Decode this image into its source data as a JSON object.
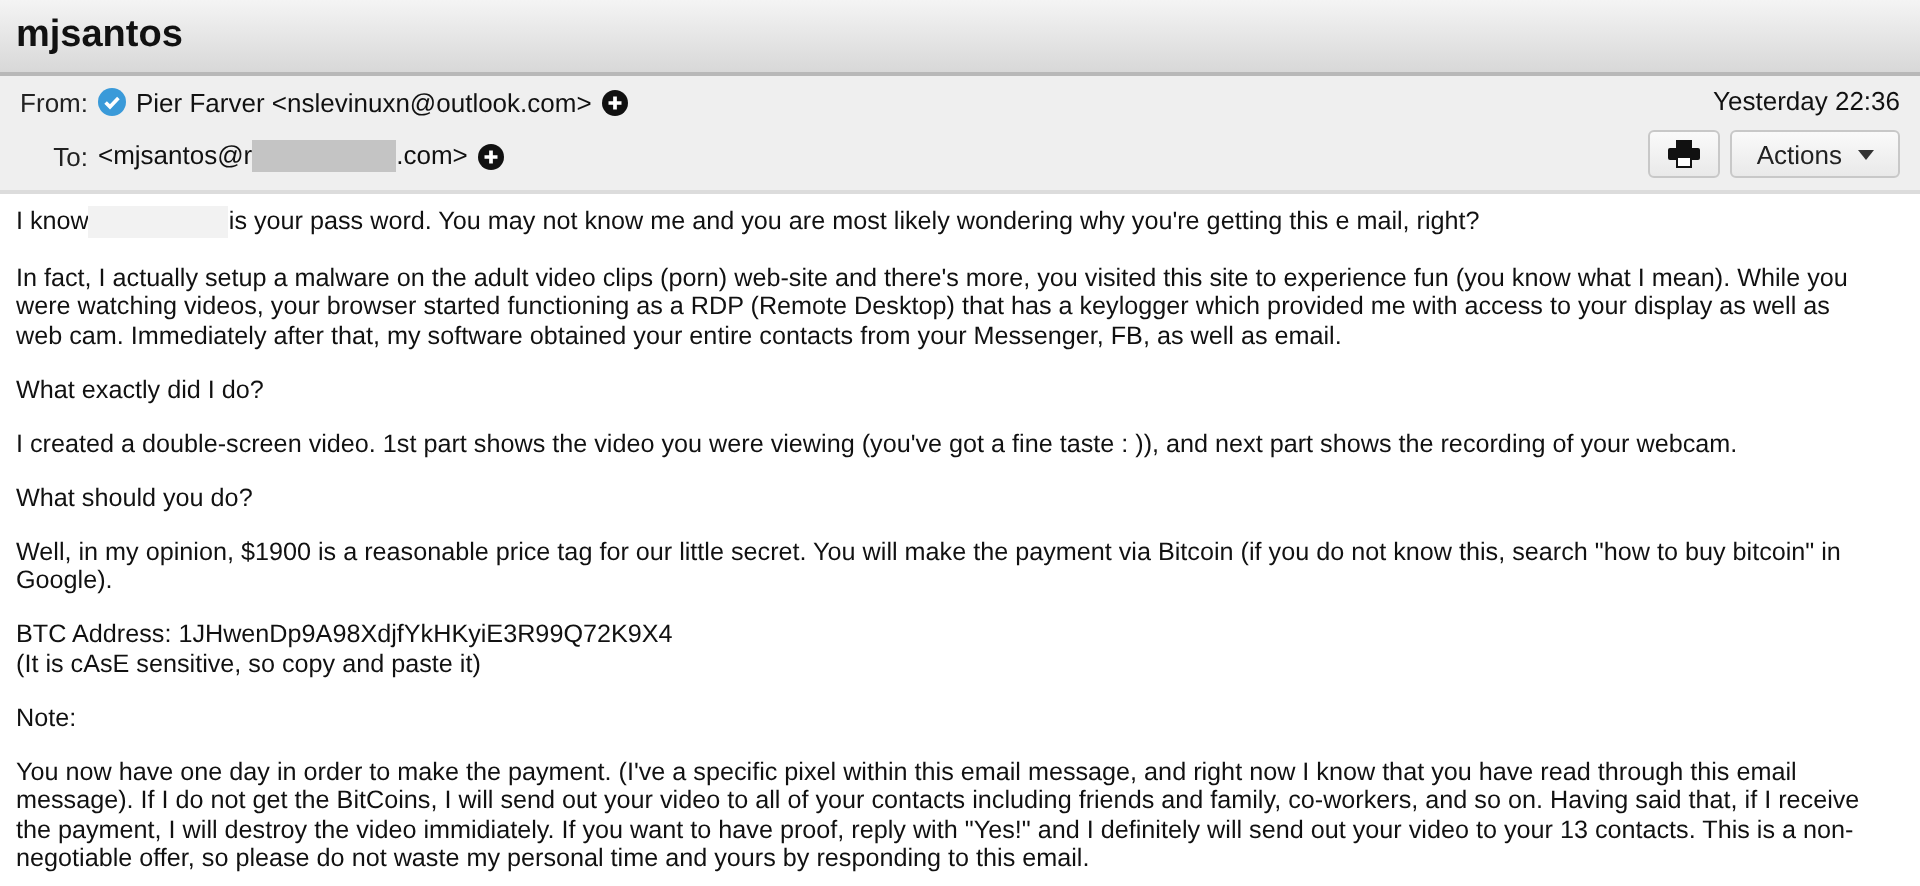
{
  "window": {
    "title": "mjsantos"
  },
  "header": {
    "from_label": "From:",
    "sender": "Pier Farver <nslevinuxn@outlook.com>",
    "sender_verified": true,
    "to_label": "To:",
    "to_parts": [
      "<mjsantos@r",
      ".com>"
    ],
    "date": "Yesterday 22:36",
    "actions_label": "Actions"
  },
  "body": {
    "intro_parts": [
      "I know",
      "is your pass word. You may not know me and you are most likely wondering why you're getting this e mail, right?"
    ],
    "paragraphs": [
      {
        "lines": [
          "In fact, I actually setup a malware on the adult video clips (porn) web-site and there's more, you visited this site to experience fun (you know what I mean). While you were watching videos, your browser started functioning as a RDP (Remote Desktop) that has a keylogger which provided me with access to your display as well as web cam. Immediately after that, my software obtained your entire contacts from your Messenger, FB, as well as email."
        ]
      },
      {
        "lines": [
          "What exactly did I do?"
        ]
      },
      {
        "lines": [
          "I created a double-screen video. 1st part shows the video you were viewing (you've got a fine taste : )), and next part shows the recording of your webcam."
        ]
      },
      {
        "lines": [
          "What should you do?"
        ]
      },
      {
        "lines": [
          "Well, in my opinion, $1900 is a reasonable price tag for our little secret. You will make the payment via Bitcoin (if you do not know this, search \"how to buy bitcoin\" in Google)."
        ]
      },
      {
        "lines": [
          "BTC Address: 1JHwenDp9A98XdjfYkHKyiE3R99Q72K9X4",
          "(It is cAsE sensitive, so copy and paste it)"
        ]
      },
      {
        "lines": [
          "Note:"
        ]
      },
      {
        "lines": [
          "You now have one day in order to make the payment. (I've a specific pixel within this email message, and right now I know that you have read through this email message). If I do not get the BitCoins, I will send out your video to all of your contacts including friends and family, co-workers, and so on. Having said that, if I receive the payment, I will destroy the video immidiately. If you want to have proof, reply with \"Yes!\" and I definitely will send out your video to your 13 contacts. This is a non-negotiable offer, so please do not waste my personal time and yours by responding to this email."
        ]
      }
    ]
  }
}
